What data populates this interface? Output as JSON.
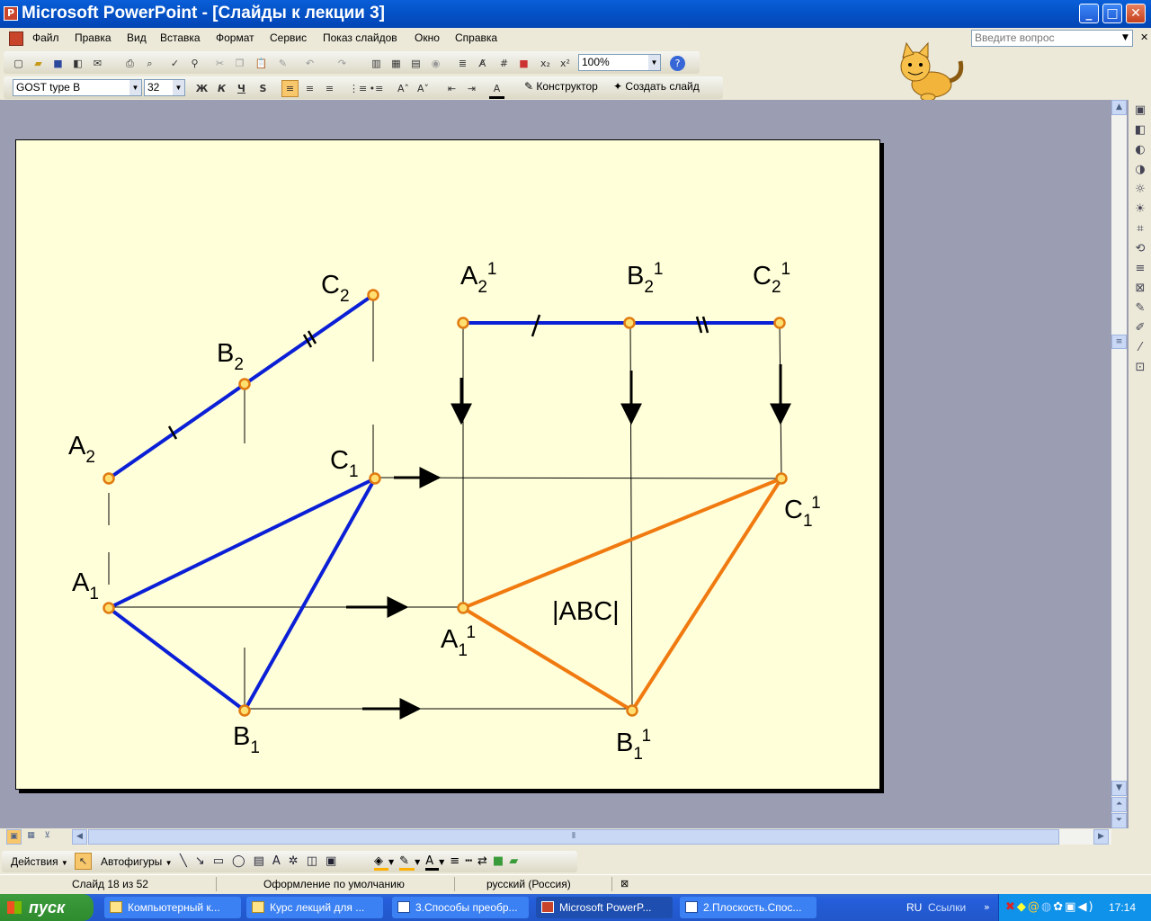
{
  "window": {
    "title": "Microsoft PowerPoint - [Слайды к лекции 3]",
    "min": "_",
    "max": "□",
    "close": "✕"
  },
  "menu": {
    "items": [
      "Файл",
      "Правка",
      "Вид",
      "Вставка",
      "Формат",
      "Сервис",
      "Показ слайдов",
      "Окно",
      "Справка"
    ],
    "ask_placeholder": "Введите вопрос"
  },
  "toolbar": {
    "zoom": "100%",
    "font_name": "GOST type B",
    "font_size": "32",
    "bold": "Ж",
    "italic": "К",
    "underline": "Ч",
    "shadow": "S",
    "designer": "Конструктор",
    "new_slide": "Создать слайд"
  },
  "slide": {
    "labels": {
      "A2": "A",
      "B2": "B",
      "C2": "C",
      "A1": "A",
      "B1": "B",
      "C1": "C",
      "A21": "A",
      "B21": "B",
      "C21": "C",
      "A11": "A",
      "B11": "B",
      "C11": "C",
      "sub2": "2",
      "sub1": "1",
      "sup1": "1",
      "abc": "|ABC|"
    },
    "colors": {
      "blue": "#0a1fd6",
      "orange": "#f07a10",
      "point_fill": "#ffdf70",
      "point_stroke": "#e07a10"
    }
  },
  "drawbar": {
    "actions": "Действия",
    "autoshapes": "Автофигуры"
  },
  "status": {
    "slide": "Слайд 18 из 52",
    "design": "Оформление по умолчанию",
    "lang": "русский (Россия)"
  },
  "taskbar": {
    "start": "пуск",
    "tasks": [
      "Компьютерный к...",
      "Курс лекций для ...",
      "3.Способы преобр...",
      "Microsoft PowerP...",
      "2.Плоскость.Спос..."
    ],
    "lang": "RU",
    "links": "Ссылки",
    "clock": "17:14"
  }
}
